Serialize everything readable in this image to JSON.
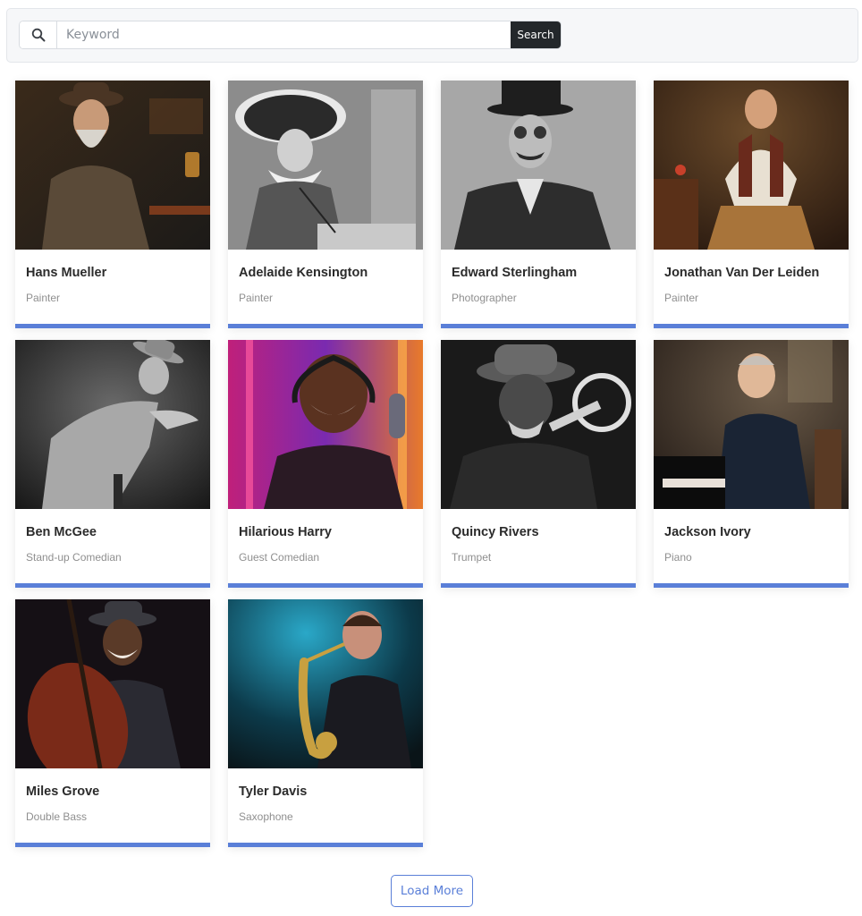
{
  "search": {
    "placeholder": "Keyword",
    "value": "",
    "button_label": "Search",
    "icon": "search-icon"
  },
  "colors": {
    "accent": "#5a7fd8",
    "search_button_bg": "#23272b"
  },
  "people": [
    {
      "name": "Hans Mueller",
      "role": "Painter",
      "photo": "warm-sepia"
    },
    {
      "name": "Adelaide Kensington",
      "role": "Painter",
      "photo": "mono"
    },
    {
      "name": "Edward Sterlingham",
      "role": "Photographer",
      "photo": "mono"
    },
    {
      "name": "Jonathan Van Der Leiden",
      "role": "Painter",
      "photo": "warm-oil"
    },
    {
      "name": "Ben McGee",
      "role": "Stand-up Comedian",
      "photo": "mono-dark"
    },
    {
      "name": "Hilarious Harry",
      "role": "Guest Comedian",
      "photo": "neon"
    },
    {
      "name": "Quincy Rivers",
      "role": "Trumpet",
      "photo": "mono-dark"
    },
    {
      "name": "Jackson Ivory",
      "role": "Piano",
      "photo": "warm-dark"
    },
    {
      "name": "Miles Grove",
      "role": "Double Bass",
      "photo": "dark-red"
    },
    {
      "name": "Tyler Davis",
      "role": "Saxophone",
      "photo": "teal-stage"
    }
  ],
  "load_more_label": "Load More"
}
